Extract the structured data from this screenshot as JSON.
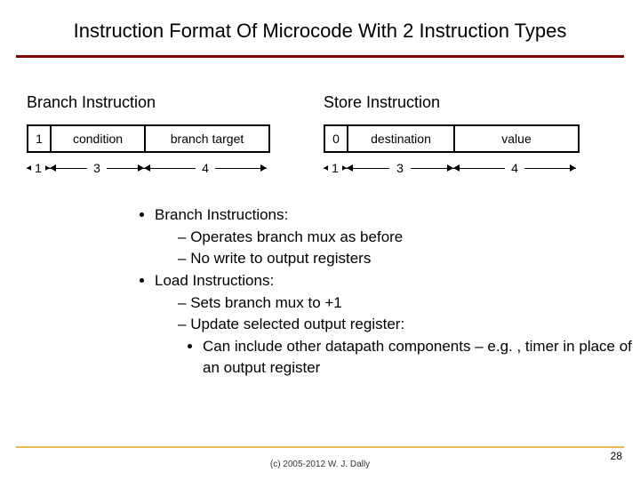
{
  "title": "Instruction Format Of Microcode With 2 Instruction Types",
  "branch": {
    "title": "Branch Instruction",
    "fields": {
      "op": "1",
      "cond": "condition",
      "target": "branch target"
    },
    "widths": {
      "op": "1",
      "cond": "3",
      "target": "4"
    }
  },
  "store": {
    "title": "Store Instruction",
    "fields": {
      "op": "0",
      "dest": "destination",
      "value": "value"
    },
    "widths": {
      "op": "1",
      "dest": "3",
      "value": "4"
    }
  },
  "bullets": {
    "b1": "Branch Instructions:",
    "b1a": "Operates branch mux as before",
    "b1b": "No write to output registers",
    "b2": "Load Instructions:",
    "b2a": "Sets branch mux to +1",
    "b2b": "Update selected output register:",
    "b2b1": "Can include other datapath components – e.g. , timer in place of an output register"
  },
  "footer": "(c) 2005-2012 W. J. Dally",
  "page": "28"
}
